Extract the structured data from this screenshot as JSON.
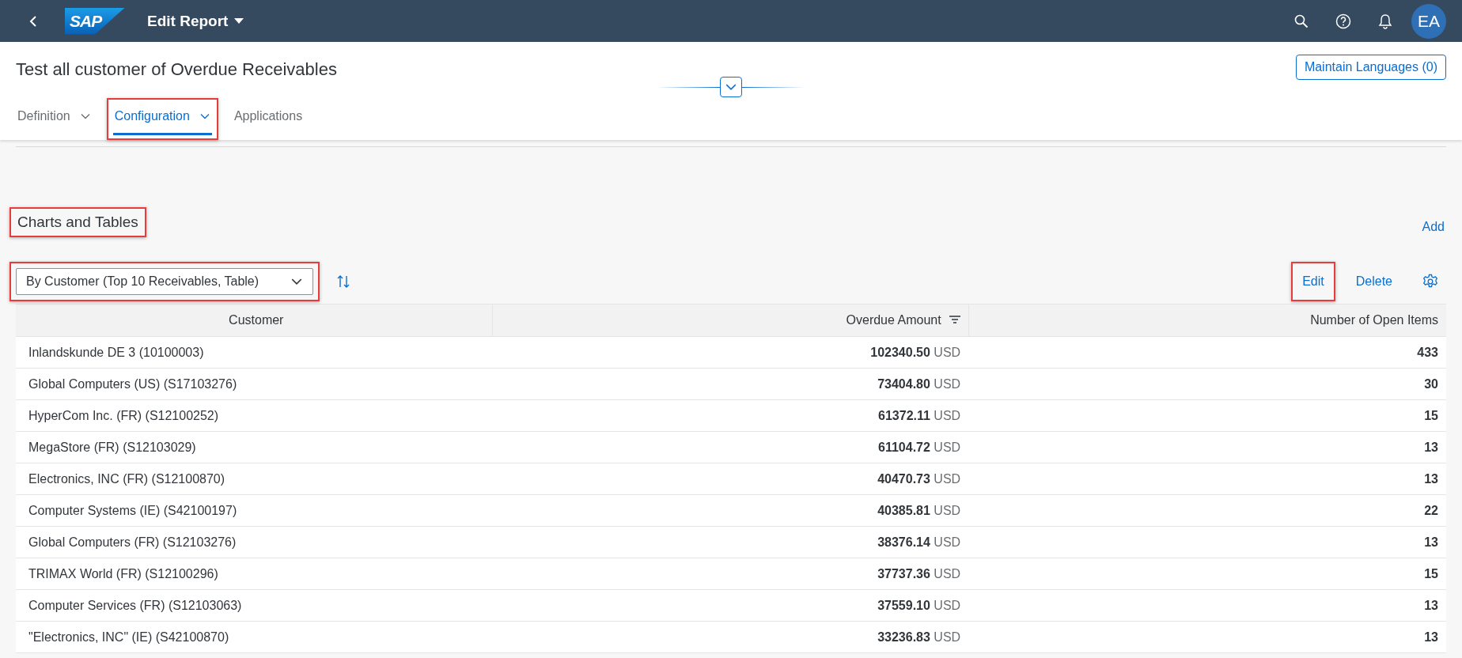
{
  "shell": {
    "logo": "SAP",
    "title": "Edit Report",
    "avatar": "EA"
  },
  "page": {
    "title": "Test all customer of Overdue Receivables",
    "header_button": "Maintain Languages (0)"
  },
  "tabs": [
    {
      "label": "Definition",
      "selected": false,
      "has_menu": true,
      "highlighted": false
    },
    {
      "label": "Configuration",
      "selected": true,
      "has_menu": true,
      "highlighted": true
    },
    {
      "label": "Applications",
      "selected": false,
      "has_menu": false,
      "highlighted": false
    }
  ],
  "section": {
    "title": "Charts and Tables",
    "highlighted": true,
    "add_link": "Add"
  },
  "variant_select": {
    "value": "By Customer (Top 10 Receivables, Table)",
    "highlighted": true
  },
  "actions": [
    {
      "label": "Edit",
      "highlighted": true
    },
    {
      "label": "Delete",
      "highlighted": false
    }
  ],
  "table": {
    "columns": [
      {
        "label": "Customer",
        "sorted": false
      },
      {
        "label": "Overdue Amount",
        "sorted": true
      },
      {
        "label": "Number of Open Items",
        "sorted": false
      }
    ],
    "rows": [
      {
        "customer": "Inlandskunde DE 3 (10100003)",
        "amount": "102340.50",
        "currency": "USD",
        "open_items": "433"
      },
      {
        "customer": "Global Computers (US) (S17103276)",
        "amount": "73404.80",
        "currency": "USD",
        "open_items": "30"
      },
      {
        "customer": "HyperCom Inc. (FR) (S12100252)",
        "amount": "61372.11",
        "currency": "USD",
        "open_items": "15"
      },
      {
        "customer": "MegaStore (FR) (S12103029)",
        "amount": "61104.72",
        "currency": "USD",
        "open_items": "13"
      },
      {
        "customer": "Electronics, INC (FR) (S12100870)",
        "amount": "40470.73",
        "currency": "USD",
        "open_items": "13"
      },
      {
        "customer": "Computer Systems (IE) (S42100197)",
        "amount": "40385.81",
        "currency": "USD",
        "open_items": "22"
      },
      {
        "customer": "Global Computers (FR) (S12103276)",
        "amount": "38376.14",
        "currency": "USD",
        "open_items": "13"
      },
      {
        "customer": "TRIMAX World (FR) (S12100296)",
        "amount": "37737.36",
        "currency": "USD",
        "open_items": "15"
      },
      {
        "customer": "Computer Services (FR) (S12103063)",
        "amount": "37559.10",
        "currency": "USD",
        "open_items": "13"
      },
      {
        "customer": "\"Electronics, INC\" (IE) (S42100870)",
        "amount": "33236.83",
        "currency": "USD",
        "open_items": "13"
      }
    ]
  }
}
